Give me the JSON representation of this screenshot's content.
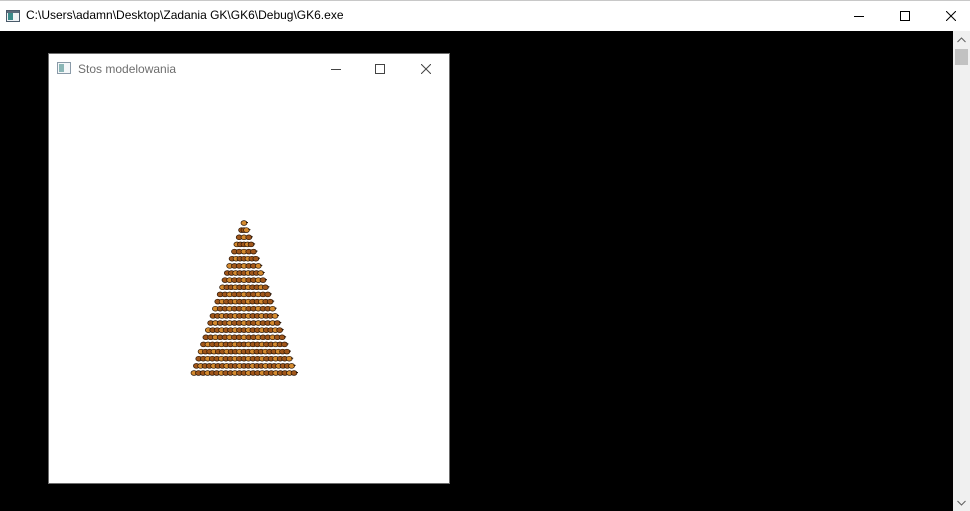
{
  "console_window": {
    "title": "C:\\Users\\adamn\\Desktop\\Zadania GK\\GK6\\Debug\\GK6.exe",
    "icon": "console-app-icon"
  },
  "gl_window": {
    "title": "Stos modelowania",
    "icon": "opengl-app-icon",
    "scene": {
      "description_shape": "pyramid-stack",
      "colors": {
        "primary": "#a0561a",
        "highlight": "#d48a2e",
        "outline": "#2a1505"
      }
    }
  },
  "colors": {
    "console_background": "#000000",
    "titlebar_background": "#ffffff",
    "scrollbar_track": "#f0f0f0",
    "scrollbar_thumb": "#c2c2c2"
  }
}
